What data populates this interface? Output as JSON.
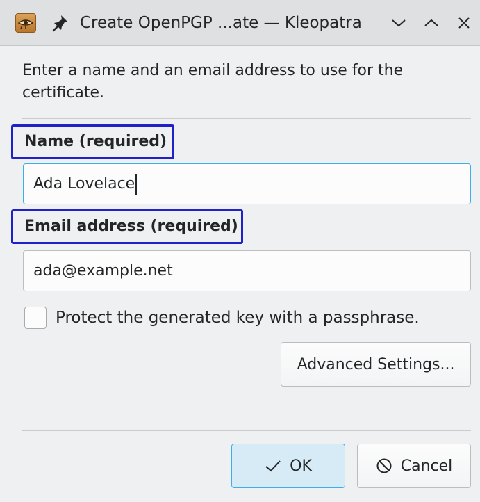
{
  "window": {
    "title": "Create OpenPGP ...ate — Kleopatra",
    "app_icon": "kleopatra-eye-icon",
    "pin_icon": "pin-icon",
    "controls": [
      "minimize-chevron-down-icon",
      "maximize-chevron-up-icon",
      "close-x-icon"
    ]
  },
  "dialog": {
    "intro_text": "Enter a name and an email address to use for the certificate.",
    "name_label": "Name (required)",
    "name_value": "Ada Lovelace",
    "email_label": "Email address (required)",
    "email_value": "ada@example.net",
    "passphrase_checkbox_label": "Protect the generated key with a passphrase.",
    "passphrase_checked": false,
    "advanced_settings_label": "Advanced Settings...",
    "ok_label": "OK",
    "cancel_label": "Cancel"
  },
  "colors": {
    "highlight_border": "#1f22c8",
    "focus_accent": "#3daee9",
    "default_button_fill": "#d6ebf6",
    "window_background": "#eff0f1"
  }
}
